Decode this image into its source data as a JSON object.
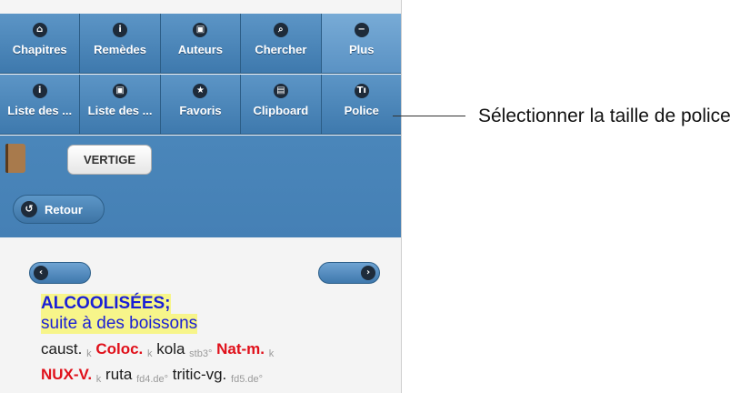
{
  "nav": {
    "row1": [
      {
        "label": "Chapitres",
        "icon": "home-icon",
        "glyph": "⌂",
        "active": false
      },
      {
        "label": "Remèdes",
        "icon": "info-icon",
        "glyph": "i",
        "active": false
      },
      {
        "label": "Auteurs",
        "icon": "contact-icon",
        "glyph": "▣",
        "active": false
      },
      {
        "label": "Chercher",
        "icon": "search-icon",
        "glyph": "⌕",
        "active": false
      },
      {
        "label": "Plus",
        "icon": "minus-icon",
        "glyph": "−",
        "active": true
      }
    ],
    "row2": [
      {
        "label": "Liste des ...",
        "icon": "info-icon",
        "glyph": "i"
      },
      {
        "label": "Liste des ...",
        "icon": "contact-icon",
        "glyph": "▣"
      },
      {
        "label": "Favoris",
        "icon": "star-icon",
        "glyph": "★"
      },
      {
        "label": "Clipboard",
        "icon": "clipboard-icon",
        "glyph": "▤"
      },
      {
        "label": "Police",
        "icon": "font-size-icon",
        "glyph": "Tı"
      }
    ]
  },
  "toolbar": {
    "topic_label": "VERTIGE",
    "back_label": "Retour"
  },
  "content": {
    "rubric_title": "ALCOOLISÉES;",
    "rubric_sub": "suite à des boissons",
    "line1": [
      {
        "text": "caust.",
        "style": "normal"
      },
      {
        "text": "k",
        "style": "grade"
      },
      {
        "text": "Coloc.",
        "style": "red"
      },
      {
        "text": "k",
        "style": "grade"
      },
      {
        "text": "kola",
        "style": "normal"
      },
      {
        "text": "stb3°",
        "style": "grade"
      },
      {
        "text": "Nat-m.",
        "style": "red"
      },
      {
        "text": "k",
        "style": "grade"
      }
    ],
    "line2": [
      {
        "text": "NUX-V.",
        "style": "red"
      },
      {
        "text": "k",
        "style": "grade"
      },
      {
        "text": "ruta",
        "style": "normal"
      },
      {
        "text": "fd4.de°",
        "style": "grade"
      },
      {
        "text": "tritic-vg.",
        "style": "normal"
      },
      {
        "text": "fd5.de°",
        "style": "grade"
      }
    ]
  },
  "callout": {
    "text": "Sélectionner la taille de police"
  },
  "colors": {
    "nav_blue": "#4a86ba",
    "rubric_blue": "#1a1fd6",
    "highlight": "#f7f58a",
    "remedy_red": "#e0101a"
  }
}
